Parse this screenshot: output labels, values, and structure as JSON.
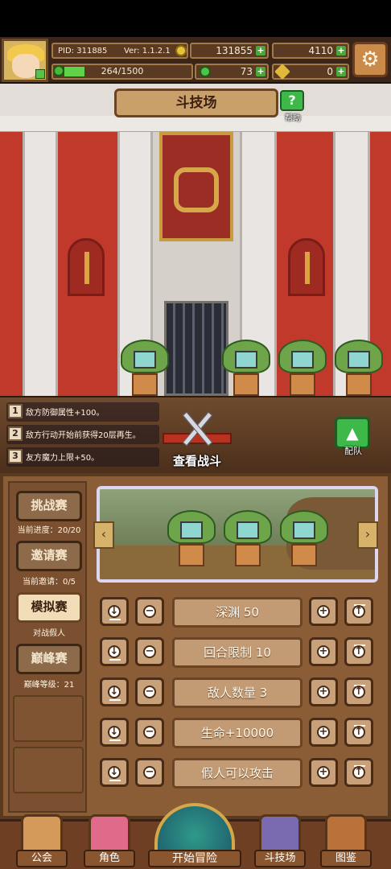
{
  "header": {
    "pid": "PID: 311885",
    "version": "Ver: 1.1.2.1",
    "gold": "131855",
    "gems": "4110",
    "stamina": "264/1500",
    "stamina_fraction": 0.176,
    "clover": "73",
    "keys": "0"
  },
  "scene": {
    "title": "斗技场",
    "help_label": "帮助"
  },
  "modifiers": [
    {
      "num": "1",
      "text": "敌方防御属性+100。"
    },
    {
      "num": "2",
      "text": "敌方行动开始前获得20层再生。"
    },
    {
      "num": "3",
      "text": "友方魔力上限+50。"
    }
  ],
  "actions": {
    "view_battle": "查看战斗",
    "team": "配队"
  },
  "modes": [
    {
      "label": "挑战赛",
      "sub": "当前进度：20/20",
      "active": false
    },
    {
      "label": "邀请赛",
      "sub": "当前邀请：0/5",
      "active": false
    },
    {
      "label": "模拟赛",
      "sub": "对战假人",
      "active": true
    },
    {
      "label": "巅峰赛",
      "sub": "巅峰等级：21",
      "active": false
    }
  ],
  "settings": [
    {
      "label": "深渊 50"
    },
    {
      "label": "回合限制 10"
    },
    {
      "label": "敌人数量 3"
    },
    {
      "label": "生命+10000"
    },
    {
      "label": "假人可以攻击"
    }
  ],
  "nav": {
    "guild": "公会",
    "character": "角色",
    "adventure": "开始冒险",
    "arena": "斗技场",
    "codex": "图鉴"
  },
  "colors": {
    "panel": "#8a5d36",
    "accent_green": "#3fb84a",
    "wall_red": "#c0392b"
  }
}
